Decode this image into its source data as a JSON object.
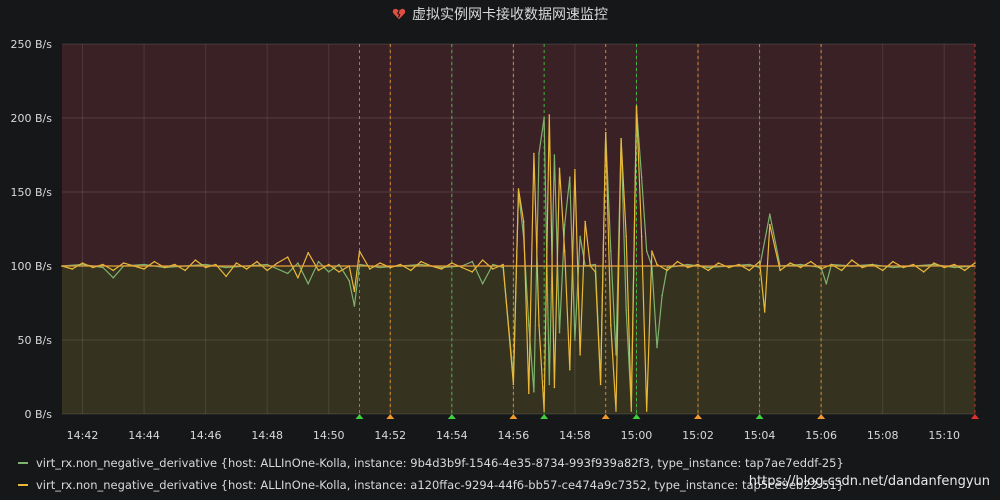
{
  "panel": {
    "title": "虚拟实例网卡接收数据网速监控",
    "alert_icon": "broken-heart-icon"
  },
  "colors": {
    "background": "#161719",
    "alert_region": "#3a2125",
    "ok_region": "#35321f",
    "threshold_line": "#e5a13b",
    "series_green": "#7eb26d",
    "series_yellow": "#eab839",
    "annotation_green": "#3fcf3f",
    "annotation_orange": "#f0982c",
    "annotation_red": "#e02f2f"
  },
  "watermark": "https://blog.csdn.net/dandanfengyun",
  "chart_data": {
    "type": "line",
    "ylim": [
      0,
      250
    ],
    "y_ticks": [
      0,
      50,
      100,
      150,
      200,
      250
    ],
    "y_tick_labels": [
      "0 B/s",
      "50 B/s",
      "100 B/s",
      "150 B/s",
      "200 B/s",
      "250 B/s"
    ],
    "y_unit": "B/s",
    "x_range_minutes": [
      "14:41:20",
      "15:11:00"
    ],
    "x_ticks": [
      "14:42",
      "14:44",
      "14:46",
      "14:48",
      "14:50",
      "14:52",
      "14:54",
      "14:56",
      "14:58",
      "15:00",
      "15:02",
      "15:04",
      "15:06",
      "15:08",
      "15:10"
    ],
    "threshold": 100,
    "grid": true,
    "legend_placement": "bottom",
    "annotations": [
      {
        "time": "14:51:00",
        "state": "ok"
      },
      {
        "time": "14:52:00",
        "state": "pending"
      },
      {
        "time": "14:54:00",
        "state": "ok"
      },
      {
        "time": "14:56:00",
        "state": "pending"
      },
      {
        "time": "14:57:00",
        "state": "ok"
      },
      {
        "time": "14:59:00",
        "state": "pending"
      },
      {
        "time": "15:00:00",
        "state": "ok"
      },
      {
        "time": "15:02:00",
        "state": "pending"
      },
      {
        "time": "15:04:00",
        "state": "ok"
      },
      {
        "time": "15:06:00",
        "state": "pending"
      },
      {
        "time": "15:11:00",
        "state": "alerting"
      }
    ],
    "series": [
      {
        "name": "virt_rx.non_negative_derivative {host: ALLInOne-Kolla, instance: 9b4d3b9f-1546-4e35-8734-993f939a82f3, type_instance: tap7ae7eddf-25}",
        "color": "#7eb26d",
        "points": [
          [
            "14:41:20",
            100
          ],
          [
            "14:42:00",
            101
          ],
          [
            "14:42:40",
            99
          ],
          [
            "14:43:00",
            92
          ],
          [
            "14:43:20",
            100
          ],
          [
            "14:44:00",
            101
          ],
          [
            "14:44:40",
            99
          ],
          [
            "14:45:20",
            100
          ],
          [
            "14:46:00",
            101
          ],
          [
            "14:46:40",
            99
          ],
          [
            "14:47:20",
            100
          ],
          [
            "14:48:00",
            101
          ],
          [
            "14:48:40",
            95
          ],
          [
            "14:49:00",
            102
          ],
          [
            "14:49:20",
            88
          ],
          [
            "14:49:40",
            103
          ],
          [
            "14:50:00",
            96
          ],
          [
            "14:50:20",
            101
          ],
          [
            "14:50:40",
            90
          ],
          [
            "14:50:50",
            73
          ],
          [
            "14:51:00",
            101
          ],
          [
            "14:51:40",
            99
          ],
          [
            "14:52:20",
            100
          ],
          [
            "14:53:00",
            101
          ],
          [
            "14:53:40",
            99
          ],
          [
            "14:54:20",
            100
          ],
          [
            "14:54:40",
            103
          ],
          [
            "14:55:00",
            88
          ],
          [
            "14:55:20",
            101
          ],
          [
            "14:55:40",
            99
          ],
          [
            "14:56:00",
            25
          ],
          [
            "14:56:10",
            150
          ],
          [
            "14:56:20",
            120
          ],
          [
            "14:56:30",
            60
          ],
          [
            "14:56:40",
            15
          ],
          [
            "14:56:50",
            176
          ],
          [
            "14:57:00",
            200
          ],
          [
            "14:57:10",
            20
          ],
          [
            "14:57:20",
            175
          ],
          [
            "14:57:30",
            55
          ],
          [
            "14:57:40",
            128
          ],
          [
            "14:57:50",
            160
          ],
          [
            "14:58:00",
            50
          ],
          [
            "14:58:10",
            120
          ],
          [
            "14:58:20",
            100
          ],
          [
            "14:58:40",
            101
          ],
          [
            "14:58:50",
            22
          ],
          [
            "14:59:00",
            190
          ],
          [
            "14:59:10",
            110
          ],
          [
            "14:59:20",
            40
          ],
          [
            "14:59:30",
            185
          ],
          [
            "14:59:40",
            70
          ],
          [
            "14:59:50",
            5
          ],
          [
            "15:00:00",
            207
          ],
          [
            "15:00:10",
            160
          ],
          [
            "15:00:20",
            110
          ],
          [
            "15:00:30",
            100
          ],
          [
            "15:00:40",
            45
          ],
          [
            "15:00:50",
            80
          ],
          [
            "15:01:00",
            99
          ],
          [
            "15:01:40",
            101
          ],
          [
            "15:02:20",
            99
          ],
          [
            "15:03:00",
            100
          ],
          [
            "15:03:40",
            101
          ],
          [
            "15:04:00",
            99
          ],
          [
            "15:04:20",
            135
          ],
          [
            "15:04:40",
            100
          ],
          [
            "15:05:20",
            101
          ],
          [
            "15:06:00",
            99
          ],
          [
            "15:06:10",
            88
          ],
          [
            "15:06:20",
            101
          ],
          [
            "15:07:00",
            100
          ],
          [
            "15:07:40",
            101
          ],
          [
            "15:08:20",
            99
          ],
          [
            "15:09:00",
            100
          ],
          [
            "15:09:40",
            101
          ],
          [
            "15:10:20",
            99
          ],
          [
            "15:11:00",
            100
          ]
        ]
      },
      {
        "name": "virt_rx.non_negative_derivative {host: ALLInOne-Kolla, instance: a120ffac-9294-44f6-bb57-ce474a9c7352, type_instance: tap5ce9eb22-51}",
        "color": "#eab839",
        "points": [
          [
            "14:41:20",
            100
          ],
          [
            "14:41:40",
            98
          ],
          [
            "14:42:00",
            102
          ],
          [
            "14:42:20",
            99
          ],
          [
            "14:42:40",
            101
          ],
          [
            "14:43:00",
            97
          ],
          [
            "14:43:20",
            102
          ],
          [
            "14:43:40",
            100
          ],
          [
            "14:44:00",
            98
          ],
          [
            "14:44:20",
            103
          ],
          [
            "14:44:40",
            99
          ],
          [
            "14:45:00",
            101
          ],
          [
            "14:45:20",
            97
          ],
          [
            "14:45:40",
            104
          ],
          [
            "14:46:00",
            99
          ],
          [
            "14:46:20",
            101
          ],
          [
            "14:46:40",
            93
          ],
          [
            "14:47:00",
            102
          ],
          [
            "14:47:20",
            98
          ],
          [
            "14:47:40",
            103
          ],
          [
            "14:48:00",
            97
          ],
          [
            "14:48:20",
            102
          ],
          [
            "14:48:40",
            106
          ],
          [
            "14:49:00",
            92
          ],
          [
            "14:49:20",
            109
          ],
          [
            "14:49:40",
            97
          ],
          [
            "14:50:00",
            101
          ],
          [
            "14:50:20",
            96
          ],
          [
            "14:50:40",
            100
          ],
          [
            "14:50:50",
            83
          ],
          [
            "14:51:00",
            110
          ],
          [
            "14:51:20",
            98
          ],
          [
            "14:51:40",
            102
          ],
          [
            "14:52:00",
            99
          ],
          [
            "14:52:20",
            101
          ],
          [
            "14:52:40",
            97
          ],
          [
            "14:53:00",
            103
          ],
          [
            "14:53:20",
            100
          ],
          [
            "14:53:40",
            98
          ],
          [
            "14:54:00",
            102
          ],
          [
            "14:54:20",
            99
          ],
          [
            "14:54:40",
            96
          ],
          [
            "14:55:00",
            104
          ],
          [
            "14:55:20",
            98
          ],
          [
            "14:55:40",
            101
          ],
          [
            "14:56:00",
            20
          ],
          [
            "14:56:10",
            152
          ],
          [
            "14:56:20",
            130
          ],
          [
            "14:56:30",
            14
          ],
          [
            "14:56:40",
            176
          ],
          [
            "14:56:50",
            60
          ],
          [
            "14:57:00",
            2
          ],
          [
            "14:57:10",
            202
          ],
          [
            "14:57:20",
            18
          ],
          [
            "14:57:30",
            166
          ],
          [
            "14:57:40",
            110
          ],
          [
            "14:57:50",
            30
          ],
          [
            "14:58:00",
            165
          ],
          [
            "14:58:10",
            40
          ],
          [
            "14:58:20",
            130
          ],
          [
            "14:58:30",
            100
          ],
          [
            "14:58:40",
            96
          ],
          [
            "14:58:50",
            20
          ],
          [
            "14:59:00",
            190
          ],
          [
            "14:59:10",
            60
          ],
          [
            "14:59:20",
            2
          ],
          [
            "14:59:30",
            186
          ],
          [
            "14:59:40",
            120
          ],
          [
            "14:59:50",
            2
          ],
          [
            "15:00:00",
            208
          ],
          [
            "15:00:10",
            120
          ],
          [
            "15:00:20",
            2
          ],
          [
            "15:00:30",
            110
          ],
          [
            "15:00:40",
            101
          ],
          [
            "15:01:00",
            97
          ],
          [
            "15:01:20",
            103
          ],
          [
            "15:01:40",
            99
          ],
          [
            "15:02:00",
            101
          ],
          [
            "15:02:20",
            97
          ],
          [
            "15:02:40",
            102
          ],
          [
            "15:03:00",
            99
          ],
          [
            "15:03:20",
            101
          ],
          [
            "15:03:40",
            97
          ],
          [
            "15:04:00",
            103
          ],
          [
            "15:04:10",
            69
          ],
          [
            "15:04:20",
            128
          ],
          [
            "15:04:40",
            97
          ],
          [
            "15:05:00",
            102
          ],
          [
            "15:05:20",
            99
          ],
          [
            "15:05:40",
            103
          ],
          [
            "15:06:00",
            98
          ],
          [
            "15:06:20",
            101
          ],
          [
            "15:06:40",
            97
          ],
          [
            "15:07:00",
            104
          ],
          [
            "15:07:20",
            99
          ],
          [
            "15:07:40",
            101
          ],
          [
            "15:08:00",
            97
          ],
          [
            "15:08:20",
            103
          ],
          [
            "15:08:40",
            99
          ],
          [
            "15:09:00",
            101
          ],
          [
            "15:09:20",
            96
          ],
          [
            "15:09:40",
            102
          ],
          [
            "15:10:00",
            99
          ],
          [
            "15:10:20",
            101
          ],
          [
            "15:10:40",
            97
          ],
          [
            "15:11:00",
            102
          ]
        ]
      }
    ]
  }
}
